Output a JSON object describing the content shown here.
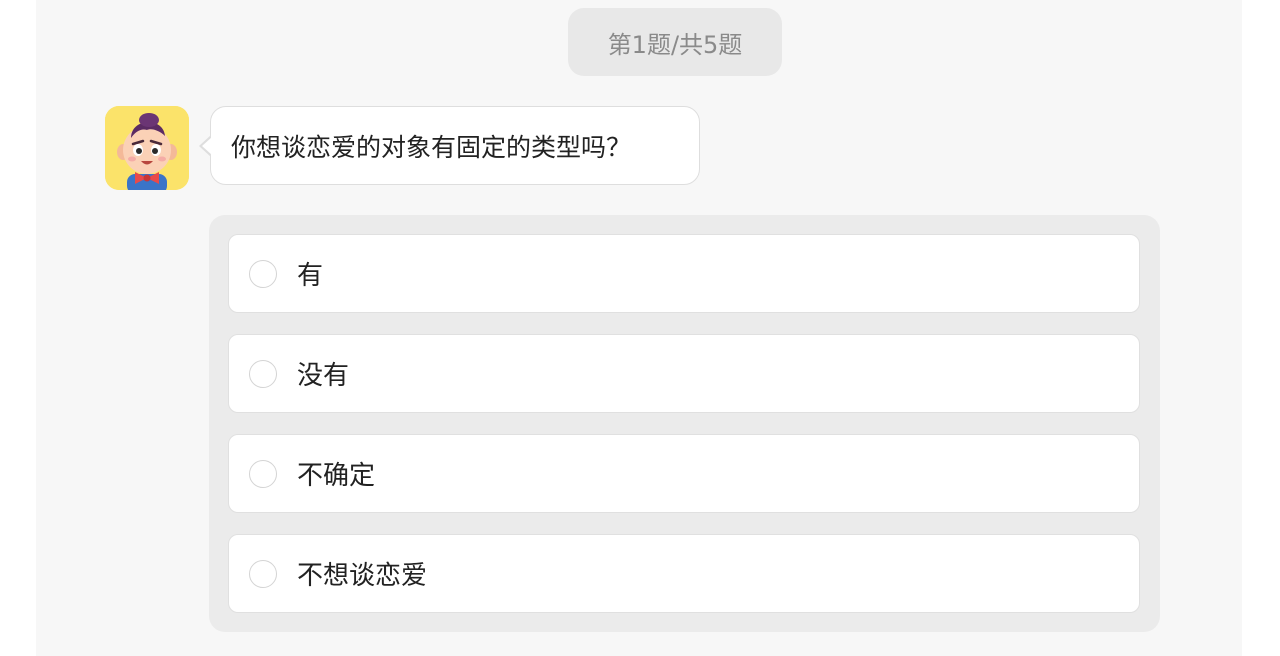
{
  "progress": {
    "text": "第1题/共5题"
  },
  "chat": {
    "avatar_icon": "boy-cartoon-avatar-icon",
    "question": "你想谈恋爱的对象有固定的类型吗？"
  },
  "options": [
    {
      "label": "有"
    },
    {
      "label": "没有"
    },
    {
      "label": "不确定"
    },
    {
      "label": "不想谈恋爱"
    }
  ],
  "colors": {
    "page_background": "#f7f7f7",
    "panel_background": "#ebebeb",
    "avatar_background": "#fbe36a",
    "text": "#222222",
    "muted_text": "#8a8a8a"
  }
}
